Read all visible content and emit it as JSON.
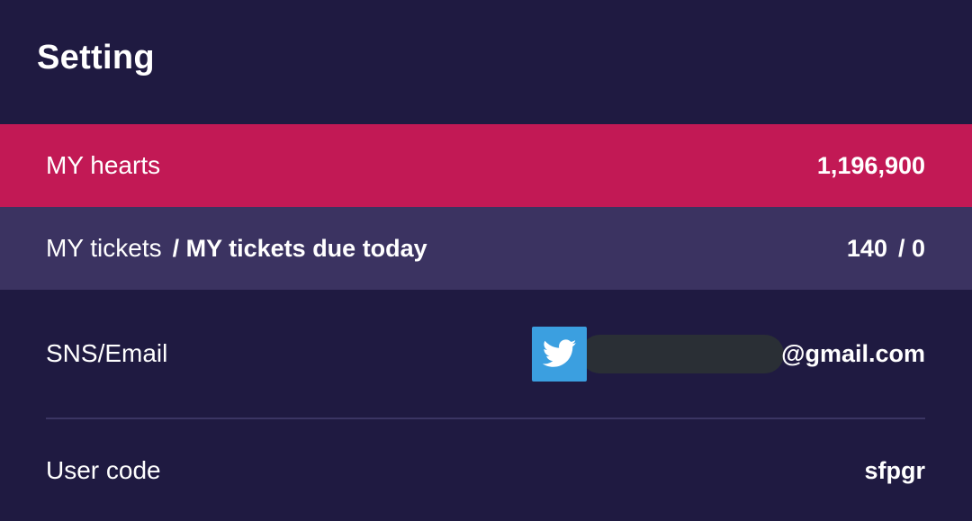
{
  "header": {
    "title": "Setting"
  },
  "hearts": {
    "label": "MY hearts",
    "value": "1,196,900"
  },
  "tickets": {
    "label": "MY tickets",
    "label_due": "/ MY tickets due today",
    "count": "140",
    "due_count": "/ 0"
  },
  "sns": {
    "label": "SNS/Email",
    "provider_icon": "twitter-icon",
    "email_domain": "@gmail.com"
  },
  "user": {
    "label": "User code",
    "code": "sfpgr"
  },
  "colors": {
    "background": "#1f1a41",
    "hearts_row": "#c21955",
    "tickets_row": "#3b3361",
    "twitter": "#3b9fe0"
  }
}
